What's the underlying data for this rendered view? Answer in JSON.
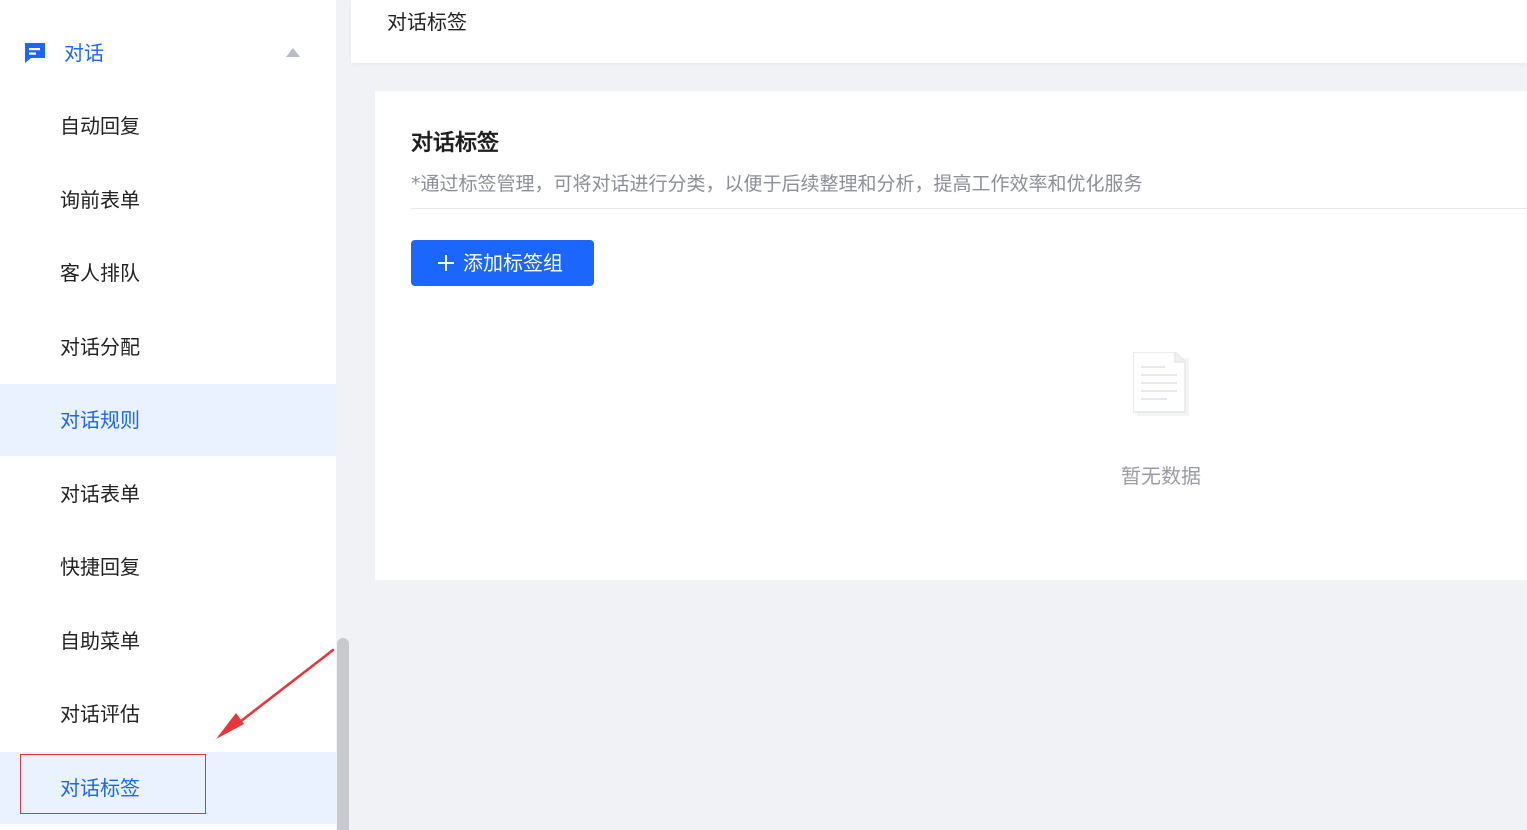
{
  "sidebar": {
    "group_label": "对话",
    "group_icon": "chat-icon",
    "collapse_icon": "caret-up-icon",
    "items": [
      {
        "label": "自动回复",
        "active": false
      },
      {
        "label": "询前表单",
        "active": false
      },
      {
        "label": "客人排队",
        "active": false
      },
      {
        "label": "对话分配",
        "active": false
      },
      {
        "label": "对话规则",
        "active": true
      },
      {
        "label": "对话表单",
        "active": false
      },
      {
        "label": "快捷回复",
        "active": false
      },
      {
        "label": "自助菜单",
        "active": false
      },
      {
        "label": "对话评估",
        "active": false
      },
      {
        "label": "对话标签",
        "active": true
      }
    ]
  },
  "topbar": {
    "title": "对话标签"
  },
  "card": {
    "title": "对话标签",
    "description": "*通过标签管理，可将对话进行分类，以便于后续整理和分析，提高工作效率和优化服务",
    "add_button_label": "添加标签组",
    "add_button_icon": "plus-icon",
    "empty_icon": "empty-document-icon",
    "empty_text": "暂无数据"
  },
  "annotation": {
    "highlight_color": "#e8343b",
    "arrow_color": "#e8343b"
  },
  "colors": {
    "accent": "#1a66ff",
    "active_bg": "#ebf2ff",
    "page_bg": "#f0f2f5"
  }
}
